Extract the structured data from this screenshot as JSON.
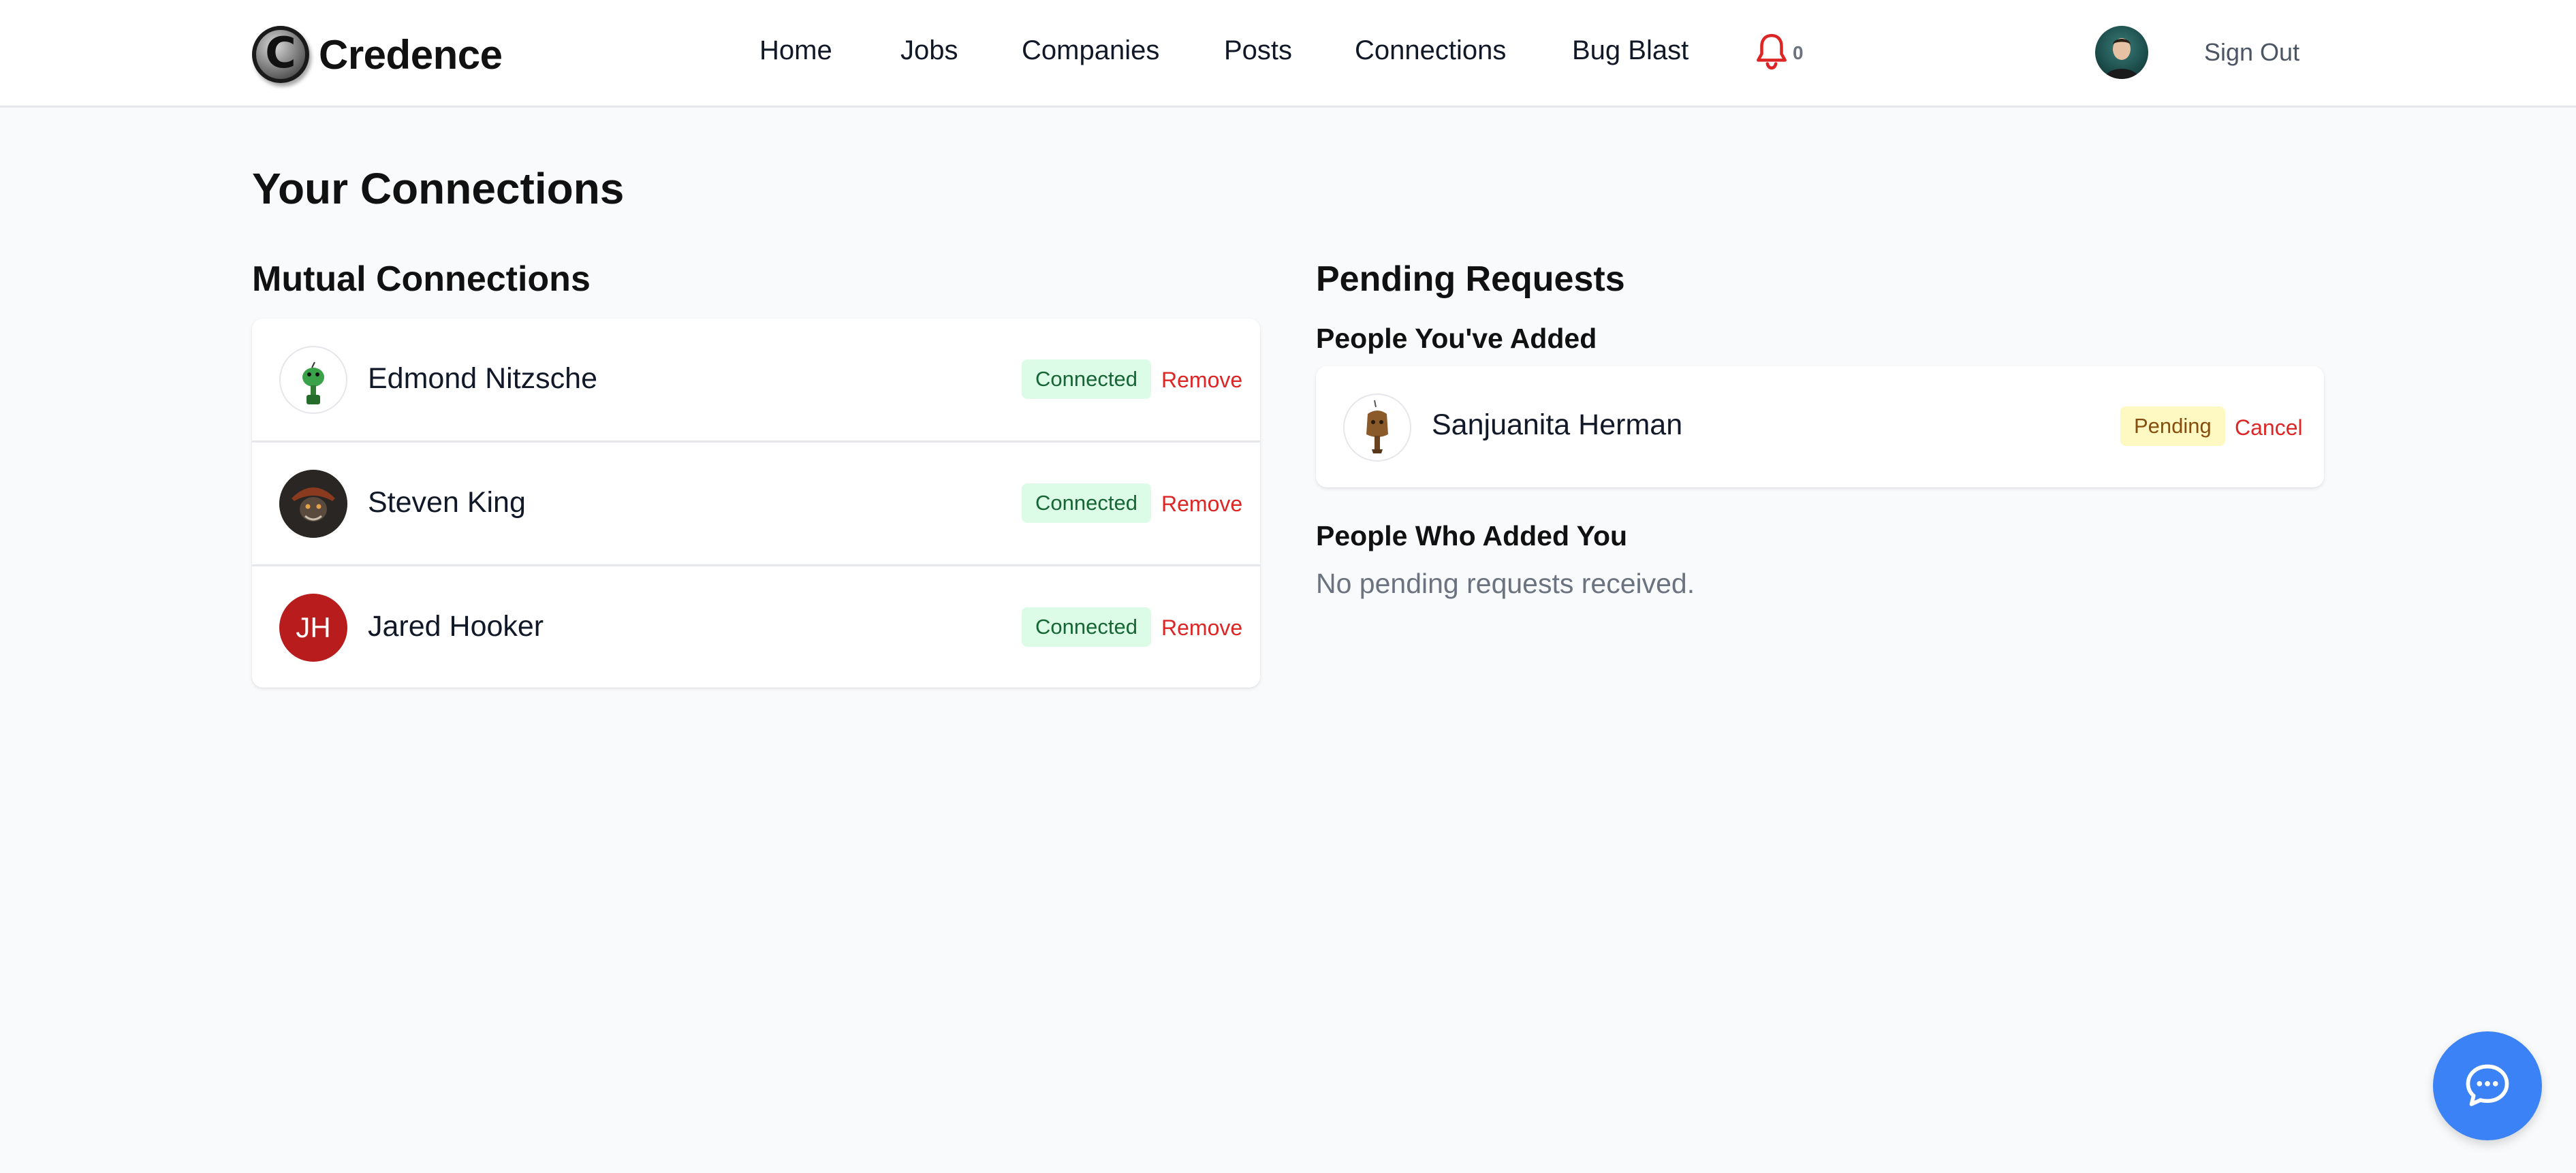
{
  "header": {
    "brand": "Credence",
    "brand_mark": "C",
    "nav": [
      {
        "label": "Home"
      },
      {
        "label": "Jobs"
      },
      {
        "label": "Companies"
      },
      {
        "label": "Posts"
      },
      {
        "label": "Connections"
      },
      {
        "label": "Bug Blast"
      }
    ],
    "notifications_count": "0",
    "sign_out_label": "Sign Out"
  },
  "page": {
    "title": "Your Connections"
  },
  "mutual": {
    "title": "Mutual Connections",
    "items": [
      {
        "name": "Edmond Nitzsche",
        "status": "Connected",
        "action": "Remove",
        "avatar": "green-character-avatar"
      },
      {
        "name": "Steven King",
        "status": "Connected",
        "action": "Remove",
        "avatar": "pirate-avatar"
      },
      {
        "name": "Jared Hooker",
        "status": "Connected",
        "action": "Remove",
        "avatar_initials": "JH"
      }
    ]
  },
  "pending": {
    "title": "Pending Requests",
    "added_title": "People You've Added",
    "added": [
      {
        "name": "Sanjuanita Herman",
        "status": "Pending",
        "action": "Cancel",
        "avatar": "wooden-figure-avatar"
      }
    ],
    "received_title": "People Who Added You",
    "received_empty": "No pending requests received."
  },
  "colors": {
    "accent_blue": "#3b82f6",
    "danger_red": "#dc2626",
    "success_bg": "#dcfce7",
    "pending_bg": "#fef9c3"
  },
  "icons": {
    "bell": "bell-icon",
    "chat": "chat-bubble-icon"
  }
}
